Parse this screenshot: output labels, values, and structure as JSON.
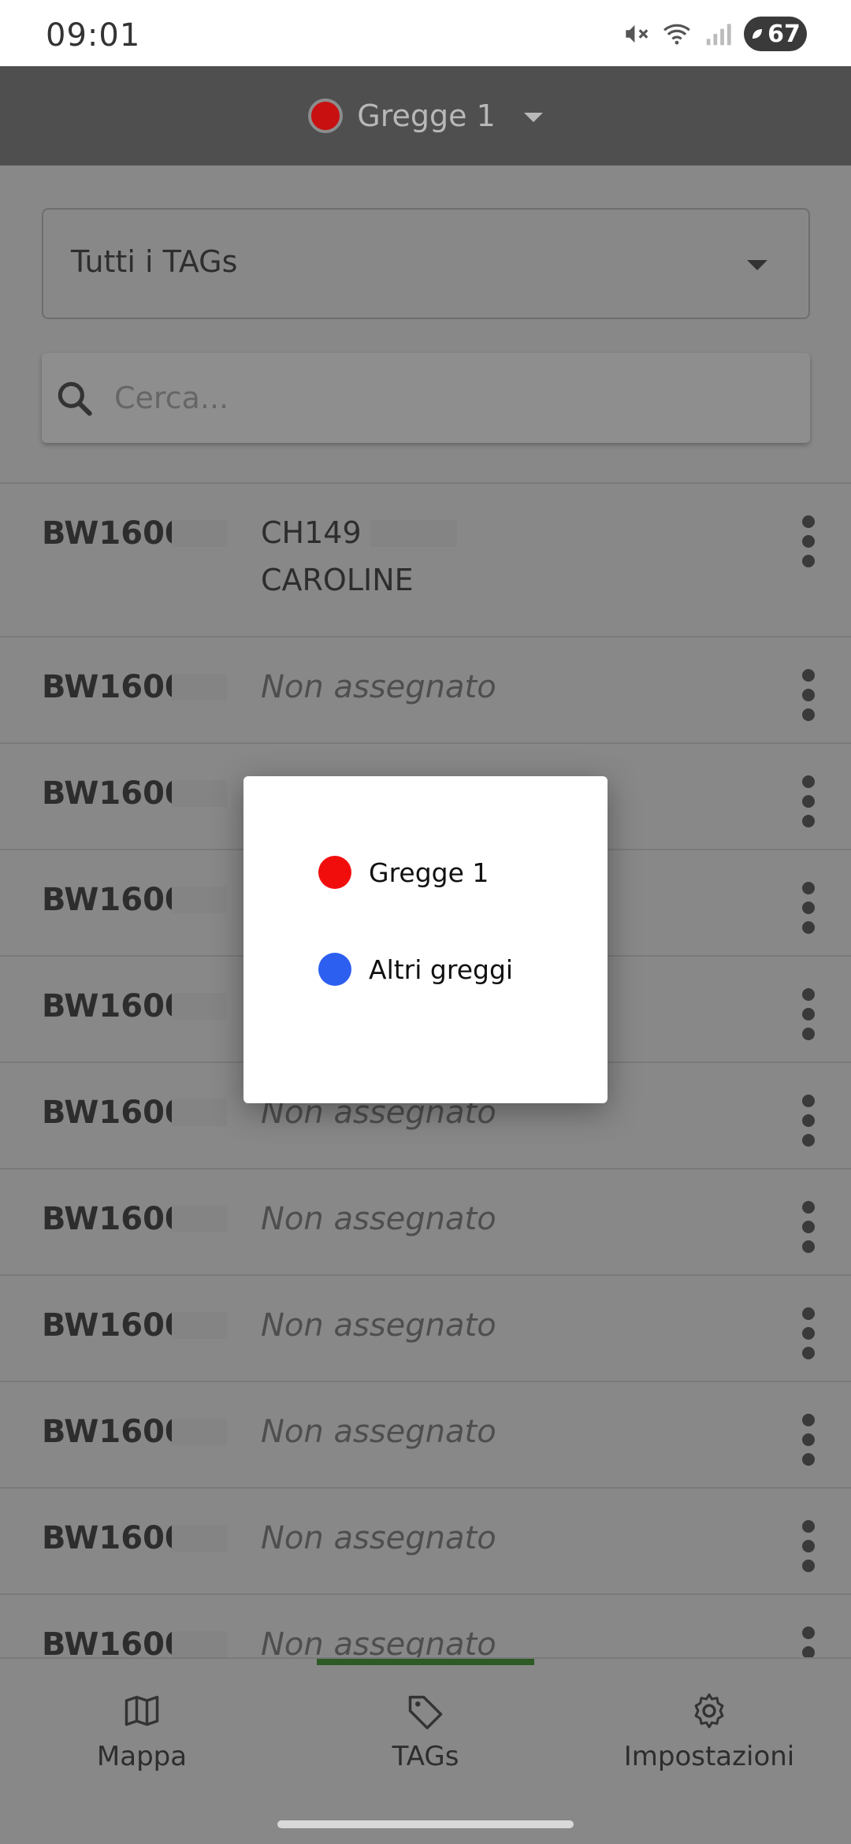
{
  "status_bar": {
    "time": "09:01",
    "battery_level": "67",
    "icons": [
      "mute-icon",
      "wifi-icon",
      "signal-icon",
      "battery-icon"
    ]
  },
  "appbar": {
    "flock_name": "Gregge 1",
    "flock_color": "#c81010"
  },
  "filter": {
    "selected": "Tutti i TAGs"
  },
  "search": {
    "placeholder": "Cerca..."
  },
  "tags": [
    {
      "id": "BW1600",
      "animal_code": "CH149",
      "animal_name": "CAROLINE"
    },
    {
      "id": "BW1600",
      "status": "Non assegnato"
    },
    {
      "id": "BW1600",
      "status": ""
    },
    {
      "id": "BW1600",
      "status": ""
    },
    {
      "id": "BW1600",
      "status": ""
    },
    {
      "id": "BW1600",
      "status": "Non assegnato"
    },
    {
      "id": "BW1600",
      "status": "Non assegnato"
    },
    {
      "id": "BW1600",
      "status": "Non assegnato"
    },
    {
      "id": "BW1600",
      "status": "Non assegnato"
    },
    {
      "id": "BW1600",
      "status": "Non assegnato"
    },
    {
      "id": "BW1600",
      "status": "Non assegnato"
    }
  ],
  "bottom_nav": {
    "items": [
      {
        "label": "Mappa",
        "icon": "map-icon"
      },
      {
        "label": "TAGs",
        "icon": "tag-icon",
        "active": true
      },
      {
        "label": "Impostazioni",
        "icon": "gear-icon"
      }
    ],
    "active_color": "#2d5a25"
  },
  "legend_dialog": {
    "options": [
      {
        "label": "Gregge 1",
        "color": "#f20d0d"
      },
      {
        "label": "Altri greggi",
        "color": "#2c5ef0"
      }
    ]
  }
}
